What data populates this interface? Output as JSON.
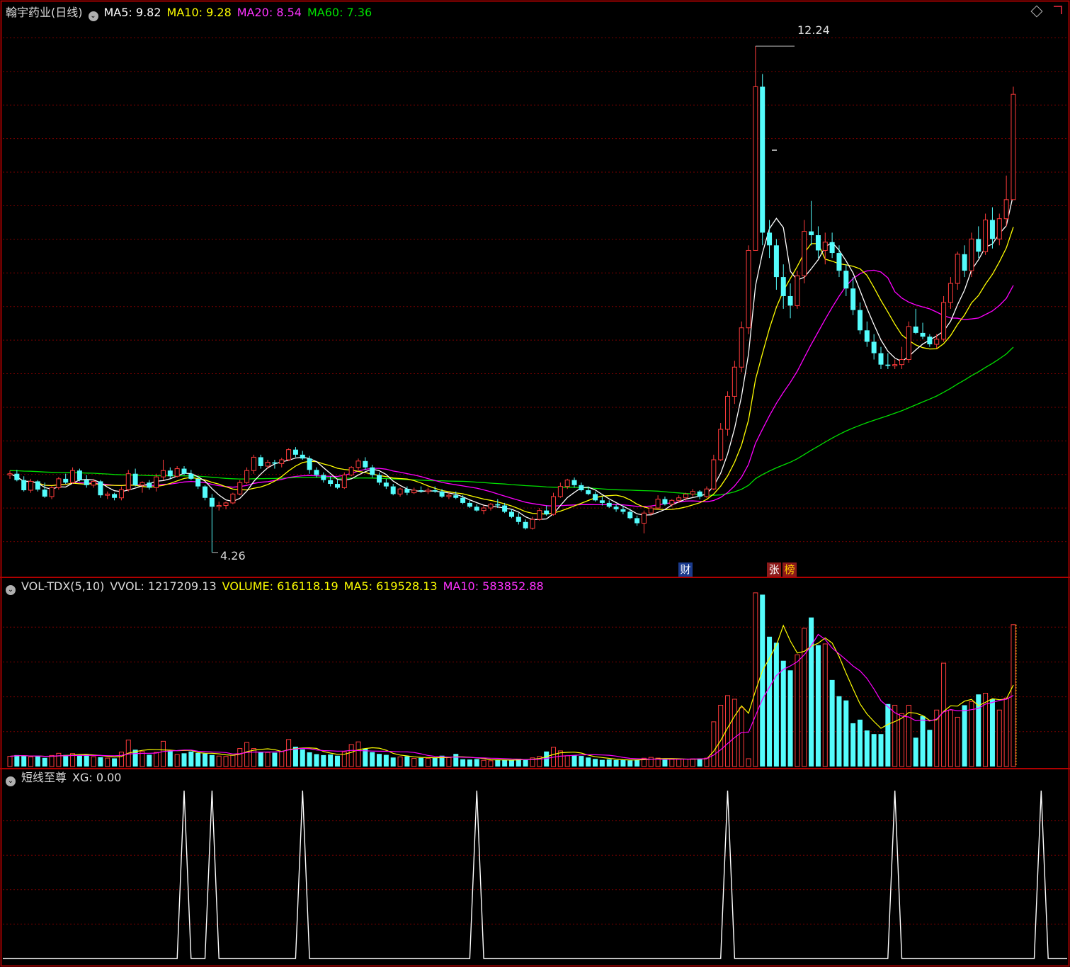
{
  "header": {
    "stock": "翰宇药业(日线)",
    "ma5": "MA5: 9.82",
    "ma10": "MA10: 9.28",
    "ma20": "MA20: 8.54",
    "ma60": "MA60: 7.36"
  },
  "vol_header": {
    "name": "VOL-TDX(5,10)",
    "vvol": "VVOL: 1217209.13",
    "volume": "VOLUME: 616118.19",
    "ma5": "MA5: 619528.13",
    "ma10": "MA10: 583852.88"
  },
  "ind_header": {
    "name": "短线至尊",
    "xg": "XG: 0.00"
  },
  "annotations": {
    "high_label": "12.24",
    "low_label": "4.26",
    "tag_cai": "财",
    "tag_zhang": "张",
    "tag_bang": "榜"
  },
  "colors": {
    "background": "#000000",
    "grid": "#7a0000",
    "up": "#ff3b3b",
    "down": "#54fcfc",
    "ma5": "#ffffff",
    "ma10": "#ffff00",
    "ma20": "#ff00ff",
    "ma60": "#00e000",
    "volume_ma5": "#ffff00",
    "volume_ma10": "#ff00ff",
    "signal": "#ffffff"
  },
  "chart_data": [
    {
      "type": "candlestick",
      "title": "翰宇药业(日线)",
      "ylim": [
        3.9,
        12.9
      ],
      "series_ohlc": [
        [
          5.48,
          5.55,
          5.42,
          5.5
        ],
        [
          5.5,
          5.56,
          5.38,
          5.4
        ],
        [
          5.4,
          5.46,
          5.22,
          5.24
        ],
        [
          5.24,
          5.42,
          5.2,
          5.38
        ],
        [
          5.38,
          5.4,
          5.22,
          5.25
        ],
        [
          5.25,
          5.36,
          5.12,
          5.14
        ],
        [
          5.14,
          5.3,
          5.1,
          5.28
        ],
        [
          5.28,
          5.45,
          5.25,
          5.42
        ],
        [
          5.42,
          5.5,
          5.34,
          5.36
        ],
        [
          5.36,
          5.6,
          5.34,
          5.55
        ],
        [
          5.55,
          5.58,
          5.38,
          5.4
        ],
        [
          5.4,
          5.48,
          5.28,
          5.32
        ],
        [
          5.32,
          5.42,
          5.28,
          5.38
        ],
        [
          5.38,
          5.4,
          5.12,
          5.16
        ],
        [
          5.16,
          5.22,
          5.1,
          5.18
        ],
        [
          5.18,
          5.2,
          5.08,
          5.12
        ],
        [
          5.12,
          5.3,
          5.08,
          5.25
        ],
        [
          5.25,
          5.56,
          5.22,
          5.5
        ],
        [
          5.5,
          5.58,
          5.3,
          5.32
        ],
        [
          5.32,
          5.38,
          5.2,
          5.36
        ],
        [
          5.36,
          5.4,
          5.25,
          5.28
        ],
        [
          5.28,
          5.5,
          5.22,
          5.45
        ],
        [
          5.45,
          5.72,
          5.4,
          5.55
        ],
        [
          5.55,
          5.6,
          5.42,
          5.46
        ],
        [
          5.46,
          5.62,
          5.44,
          5.58
        ],
        [
          5.58,
          5.62,
          5.48,
          5.5
        ],
        [
          5.5,
          5.56,
          5.4,
          5.42
        ],
        [
          5.42,
          5.46,
          5.26,
          5.3
        ],
        [
          5.3,
          5.32,
          5.08,
          5.12
        ],
        [
          5.12,
          5.18,
          4.26,
          4.98
        ],
        [
          4.98,
          5.06,
          4.92,
          5.0
        ],
        [
          5.0,
          5.06,
          4.94,
          5.04
        ],
        [
          5.04,
          5.2,
          5.02,
          5.18
        ],
        [
          5.18,
          5.4,
          5.16,
          5.36
        ],
        [
          5.36,
          5.6,
          5.34,
          5.55
        ],
        [
          5.55,
          5.8,
          5.5,
          5.76
        ],
        [
          5.76,
          5.8,
          5.58,
          5.62
        ],
        [
          5.62,
          5.72,
          5.58,
          5.68
        ],
        [
          5.68,
          5.72,
          5.58,
          5.66
        ],
        [
          5.66,
          5.75,
          5.6,
          5.72
        ],
        [
          5.72,
          5.9,
          5.7,
          5.88
        ],
        [
          5.88,
          5.92,
          5.76,
          5.8
        ],
        [
          5.8,
          5.86,
          5.72,
          5.74
        ],
        [
          5.74,
          5.78,
          5.5,
          5.56
        ],
        [
          5.56,
          5.6,
          5.44,
          5.48
        ],
        [
          5.48,
          5.52,
          5.36,
          5.4
        ],
        [
          5.4,
          5.46,
          5.3,
          5.34
        ],
        [
          5.34,
          5.4,
          5.26,
          5.28
        ],
        [
          5.28,
          5.52,
          5.26,
          5.48
        ],
        [
          5.48,
          5.62,
          5.46,
          5.6
        ],
        [
          5.6,
          5.74,
          5.56,
          5.7
        ],
        [
          5.7,
          5.76,
          5.56,
          5.6
        ],
        [
          5.6,
          5.64,
          5.44,
          5.48
        ],
        [
          5.48,
          5.52,
          5.32,
          5.36
        ],
        [
          5.36,
          5.42,
          5.26,
          5.3
        ],
        [
          5.3,
          5.34,
          5.16,
          5.18
        ],
        [
          5.18,
          5.28,
          5.14,
          5.26
        ],
        [
          5.26,
          5.3,
          5.16,
          5.2
        ],
        [
          5.2,
          5.28,
          5.18,
          5.24
        ],
        [
          5.24,
          5.3,
          5.2,
          5.22
        ],
        [
          5.22,
          5.28,
          5.18,
          5.24
        ],
        [
          5.24,
          5.3,
          5.2,
          5.22
        ],
        [
          5.22,
          5.26,
          5.12,
          5.14
        ],
        [
          5.14,
          5.2,
          5.1,
          5.16
        ],
        [
          5.16,
          5.22,
          5.1,
          5.12
        ],
        [
          5.12,
          5.16,
          5.02,
          5.04
        ],
        [
          5.04,
          5.08,
          4.96,
          4.98
        ],
        [
          4.98,
          5.02,
          4.9,
          4.92
        ],
        [
          4.92,
          5.0,
          4.86,
          4.96
        ],
        [
          4.96,
          5.04,
          4.92,
          5.02
        ],
        [
          5.02,
          5.1,
          4.96,
          5.0
        ],
        [
          5.0,
          5.04,
          4.88,
          4.9
        ],
        [
          4.9,
          4.94,
          4.8,
          4.82
        ],
        [
          4.82,
          4.88,
          4.7,
          4.74
        ],
        [
          4.74,
          4.78,
          4.62,
          4.64
        ],
        [
          4.64,
          4.82,
          4.62,
          4.78
        ],
        [
          4.78,
          4.96,
          4.76,
          4.92
        ],
        [
          4.92,
          5.0,
          4.84,
          4.86
        ],
        [
          4.86,
          5.2,
          4.84,
          5.14
        ],
        [
          5.14,
          5.36,
          5.12,
          5.3
        ],
        [
          5.3,
          5.42,
          5.26,
          5.4
        ],
        [
          5.4,
          5.44,
          5.28,
          5.32
        ],
        [
          5.32,
          5.36,
          5.22,
          5.24
        ],
        [
          5.24,
          5.3,
          5.16,
          5.18
        ],
        [
          5.18,
          5.22,
          5.06,
          5.08
        ],
        [
          5.08,
          5.14,
          5.0,
          5.04
        ],
        [
          5.04,
          5.08,
          4.96,
          4.98
        ],
        [
          4.98,
          5.02,
          4.9,
          4.94
        ],
        [
          4.94,
          5.0,
          4.86,
          4.9
        ],
        [
          4.9,
          4.94,
          4.78,
          4.8
        ],
        [
          4.8,
          4.84,
          4.68,
          4.72
        ],
        [
          4.72,
          4.92,
          4.56,
          4.88
        ],
        [
          4.88,
          5.0,
          4.84,
          4.96
        ],
        [
          4.96,
          5.16,
          4.94,
          5.1
        ],
        [
          5.1,
          5.14,
          5.0,
          5.02
        ],
        [
          5.02,
          5.1,
          4.98,
          5.08
        ],
        [
          5.08,
          5.16,
          5.04,
          5.12
        ],
        [
          5.12,
          5.2,
          5.08,
          5.18
        ],
        [
          5.18,
          5.26,
          5.14,
          5.22
        ],
        [
          5.22,
          5.24,
          5.1,
          5.14
        ],
        [
          5.14,
          5.3,
          5.12,
          5.26
        ],
        [
          5.26,
          5.8,
          5.24,
          5.72
        ],
        [
          5.72,
          6.3,
          5.7,
          6.2
        ],
        [
          6.2,
          6.8,
          6.1,
          6.72
        ],
        [
          6.72,
          7.28,
          6.6,
          7.18
        ],
        [
          7.18,
          7.9,
          7.1,
          7.8
        ],
        [
          7.8,
          9.1,
          7.7,
          9.02
        ],
        [
          9.02,
          12.24,
          10.7,
          11.6
        ],
        [
          11.6,
          11.8,
          9.1,
          9.3
        ],
        [
          9.3,
          9.5,
          8.9,
          9.1
        ],
        [
          9.1,
          9.2,
          8.4,
          8.6
        ],
        [
          8.6,
          8.8,
          8.1,
          8.3
        ],
        [
          8.3,
          8.5,
          7.95,
          8.15
        ],
        [
          8.15,
          8.7,
          8.1,
          8.62
        ],
        [
          8.62,
          9.5,
          8.5,
          9.32
        ],
        [
          9.32,
          9.8,
          9.1,
          9.26
        ],
        [
          9.26,
          9.4,
          8.9,
          9.02
        ],
        [
          9.02,
          9.3,
          8.8,
          9.15
        ],
        [
          9.15,
          9.3,
          8.9,
          8.98
        ],
        [
          8.98,
          9.1,
          8.6,
          8.7
        ],
        [
          8.7,
          8.8,
          8.3,
          8.42
        ],
        [
          8.42,
          8.6,
          8.0,
          8.08
        ],
        [
          8.08,
          8.2,
          7.7,
          7.76
        ],
        [
          7.76,
          7.9,
          7.5,
          7.58
        ],
        [
          7.58,
          7.7,
          7.3,
          7.4
        ],
        [
          7.4,
          7.5,
          7.15,
          7.22
        ],
        [
          7.22,
          7.4,
          7.15,
          7.2
        ],
        [
          7.2,
          7.3,
          7.15,
          7.22
        ],
        [
          7.22,
          7.5,
          7.15,
          7.3
        ],
        [
          7.3,
          7.9,
          7.25,
          7.82
        ],
        [
          7.82,
          8.1,
          7.7,
          7.72
        ],
        [
          7.72,
          7.88,
          7.62,
          7.66
        ],
        [
          7.66,
          7.7,
          7.5,
          7.54
        ],
        [
          7.54,
          7.7,
          7.48,
          7.62
        ],
        [
          7.62,
          8.3,
          7.58,
          8.2
        ],
        [
          8.2,
          8.6,
          8.1,
          8.5
        ],
        [
          8.5,
          9.0,
          8.4,
          8.96
        ],
        [
          8.96,
          9.1,
          8.6,
          8.7
        ],
        [
          8.7,
          9.3,
          8.6,
          9.2
        ],
        [
          9.2,
          9.4,
          8.9,
          9.0
        ],
        [
          9.0,
          9.6,
          8.95,
          9.5
        ],
        [
          9.5,
          9.7,
          9.05,
          9.2
        ],
        [
          9.2,
          9.6,
          9.1,
          9.52
        ],
        [
          9.52,
          10.2,
          9.4,
          9.82
        ],
        [
          9.82,
          11.6,
          9.82,
          11.48
        ]
      ]
    },
    {
      "type": "bar",
      "title": "VOL-TDX(5,10)",
      "ylim": [
        0,
        1450000
      ],
      "values": [
        85000,
        95000,
        90000,
        80000,
        88000,
        72000,
        92000,
        110000,
        96000,
        108000,
        94000,
        99000,
        82000,
        78000,
        70000,
        68000,
        120000,
        220000,
        140000,
        125000,
        98000,
        118000,
        210000,
        130000,
        100000,
        110000,
        125000,
        112000,
        108000,
        96000,
        87000,
        84000,
        94000,
        150000,
        200000,
        150000,
        120000,
        117000,
        115000,
        125000,
        225000,
        165000,
        143000,
        118000,
        103000,
        95000,
        100000,
        90000,
        122000,
        183000,
        205000,
        150000,
        120000,
        105000,
        97000,
        75000,
        80000,
        85000,
        68000,
        72000,
        68000,
        72000,
        90000,
        75000,
        105000,
        60000,
        58000,
        62000,
        52000,
        48000,
        57000,
        55000,
        52000,
        65000,
        60000,
        72000,
        84000,
        125000,
        160000,
        130000,
        90000,
        92000,
        88000,
        75000,
        63000,
        55000,
        59000,
        54000,
        53000,
        51000,
        56000,
        69000,
        76000,
        70000,
        57000,
        59000,
        60000,
        62000,
        64000,
        66000,
        70000,
        372000,
        510000,
        590000,
        560000,
        490000,
        65000,
        1445000,
        1430000,
        1080000,
        1030000,
        880000,
        800000,
        930000,
        1150000,
        1240000,
        1010000,
        1020000,
        720000,
        585000,
        550000,
        360000,
        390000,
        300000,
        270000,
        270000,
        520000,
        510000,
        440000,
        510000,
        240000,
        420000,
        305000,
        470000,
        860000,
        470000,
        410000,
        510000,
        540000,
        600000,
        610000,
        560000,
        470000,
        570000,
        1180000
      ],
      "series": [
        {
          "name": "VOLUME",
          "values": []
        }
      ]
    },
    {
      "type": "line",
      "title": "短线至尊",
      "ylim": [
        0,
        1
      ],
      "signal_indices": [
        25,
        29,
        42,
        67,
        103,
        127,
        148
      ]
    }
  ]
}
